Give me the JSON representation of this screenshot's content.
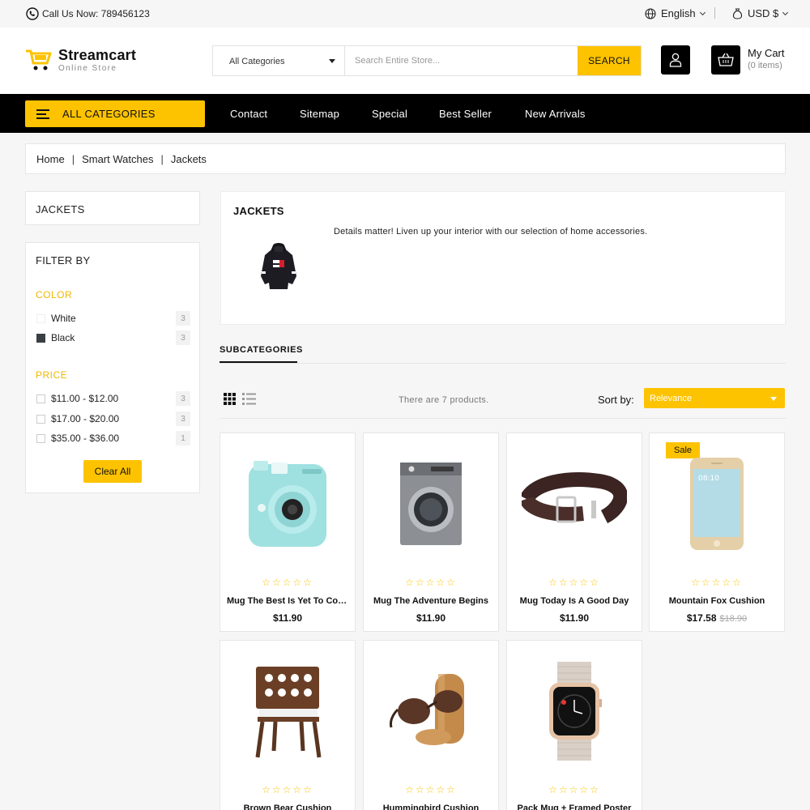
{
  "topbar": {
    "call": "Call Us Now: 789456123",
    "language": "English",
    "currency": "USD $"
  },
  "header": {
    "brand": "Streamcart",
    "tagline": "Online Store",
    "search": {
      "category": "All Categories",
      "placeholder": "Search Entire Store...",
      "button": "SEARCH"
    },
    "cart": {
      "title": "My Cart",
      "items": "(0 items)"
    }
  },
  "nav": {
    "all_categories": "ALL CATEGORIES",
    "links": [
      "Contact",
      "Sitemap",
      "Special",
      "Best Seller",
      "New Arrivals"
    ]
  },
  "breadcrumb": [
    "Home",
    "Smart Watches",
    "Jackets"
  ],
  "sidebar": {
    "title": "JACKETS",
    "filter_title": "FILTER BY",
    "color_heading": "COLOR",
    "colors": [
      {
        "label": "White",
        "count": "3",
        "swatch": "#ffffff"
      },
      {
        "label": "Black",
        "count": "3",
        "swatch": "#3a3f44"
      }
    ],
    "price_heading": "PRICE",
    "prices": [
      {
        "label": "$11.00 - $12.00",
        "count": "3"
      },
      {
        "label": "$17.00 - $20.00",
        "count": "3"
      },
      {
        "label": "$35.00 - $36.00",
        "count": "1"
      }
    ],
    "clear": "Clear All"
  },
  "category": {
    "title": "JACKETS",
    "description": "Details matter! Liven up your interior with our selection of home accessories."
  },
  "subcategories_label": "SUBCATEGORIES",
  "toolbar": {
    "count": "There are 7 products.",
    "sort_label": "Sort by:",
    "sort_value": "Relevance"
  },
  "products": [
    {
      "name": "Mug The Best Is Yet To Come",
      "price": "$11.90",
      "icon": "instant-camera",
      "stars": "☆☆☆☆☆"
    },
    {
      "name": "Mug The Adventure Begins",
      "price": "$11.90",
      "icon": "washing-machine",
      "stars": "☆☆☆☆☆"
    },
    {
      "name": "Mug Today Is A Good Day",
      "price": "$11.90",
      "icon": "belt",
      "stars": "☆☆☆☆☆"
    },
    {
      "name": "Mountain Fox Cushion",
      "price": "$17.58",
      "old_price": "$18.90",
      "badge": "Sale",
      "icon": "smartphone",
      "stars": "☆☆☆☆☆"
    },
    {
      "name": "Brown Bear Cushion",
      "price": "",
      "icon": "chair",
      "stars": "☆☆☆☆☆"
    },
    {
      "name": "Hummingbird Cushion",
      "price": "",
      "icon": "sunglasses",
      "stars": "☆☆☆☆☆"
    },
    {
      "name": "Pack Mug + Framed Poster",
      "price": "",
      "icon": "smartwatch",
      "stars": "☆☆☆☆☆"
    }
  ],
  "colors": {
    "accent": "#fdc300",
    "nav_bg": "#000000",
    "page_bg": "#f6f6f6"
  }
}
